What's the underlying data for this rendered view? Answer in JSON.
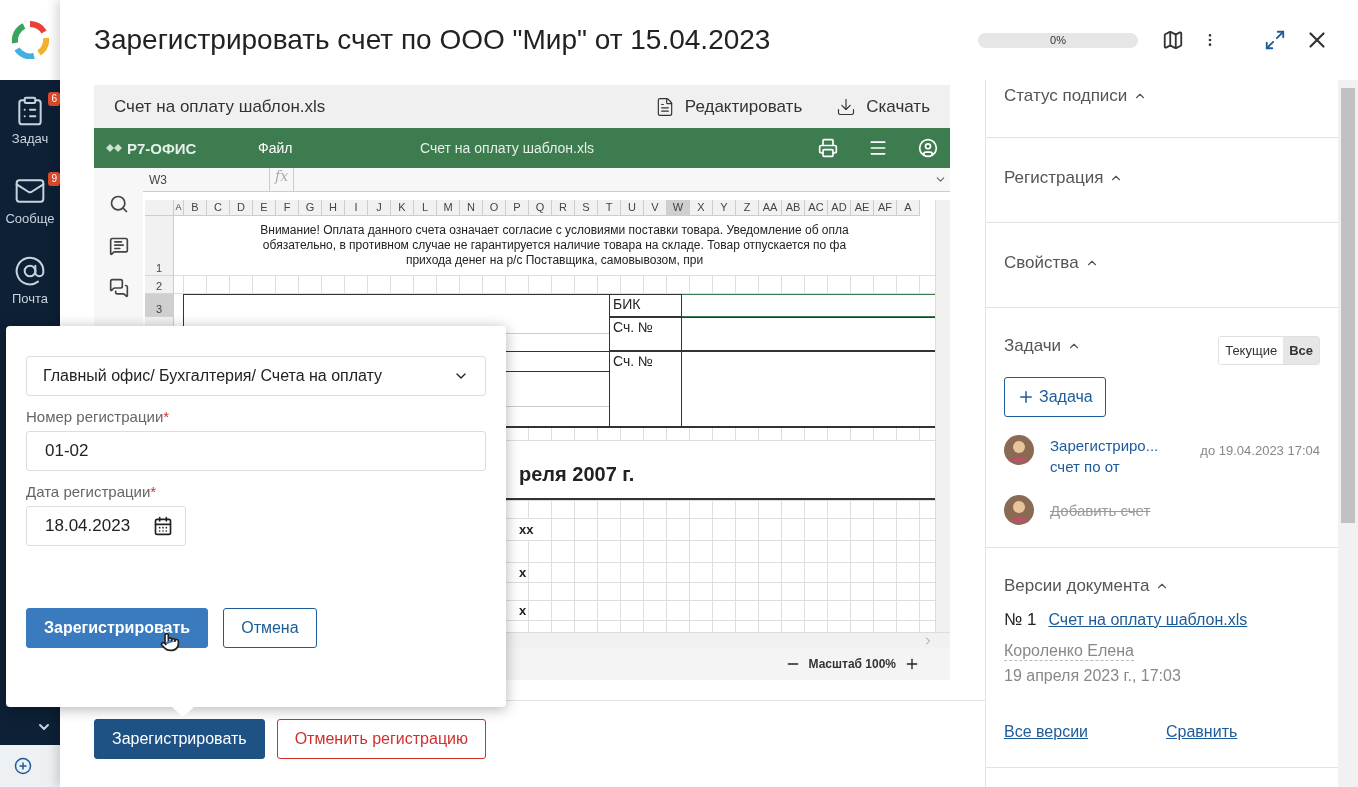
{
  "sidebar": {
    "items": [
      {
        "kind": "tasks",
        "label": "Задач",
        "badge": "6"
      },
      {
        "kind": "messages",
        "label": "Сообще",
        "badge": "9"
      },
      {
        "kind": "mail",
        "label": "Почта"
      }
    ]
  },
  "modal": {
    "title": "Зарегистрировать счет по ООО \"Мир\" от 15.04.2023",
    "progress": {
      "level": 0,
      "reading": "0%"
    }
  },
  "viewer": {
    "file_name": "Счет на оплату шаблон.xls",
    "actions": [
      {
        "kind": "edit",
        "label": "Редактировать"
      },
      {
        "kind": "download",
        "label": "Скачать"
      }
    ],
    "editor": {
      "brand": "Р7-ОФИС",
      "menu": "Файл",
      "title": "Счет на оплату шаблон.xls",
      "cell_ref": "W3",
      "formula_label": "fx"
    },
    "sheet": {
      "columns": [
        {
          "label": "A",
          "selected": false
        },
        {
          "label": "B",
          "selected": false
        },
        {
          "label": "C",
          "selected": false
        },
        {
          "label": "D",
          "selected": false
        },
        {
          "label": "E",
          "selected": false
        },
        {
          "label": "F",
          "selected": false
        },
        {
          "label": "G",
          "selected": false
        },
        {
          "label": "H",
          "selected": false
        },
        {
          "label": "I",
          "selected": false
        },
        {
          "label": "J",
          "selected": false
        },
        {
          "label": "K",
          "selected": false
        },
        {
          "label": "L",
          "selected": false
        },
        {
          "label": "M",
          "selected": false
        },
        {
          "label": "N",
          "selected": false
        },
        {
          "label": "O",
          "selected": false
        },
        {
          "label": "P",
          "selected": false
        },
        {
          "label": "Q",
          "selected": false
        },
        {
          "label": "R",
          "selected": false
        },
        {
          "label": "S",
          "selected": false
        },
        {
          "label": "T",
          "selected": false
        },
        {
          "label": "U",
          "selected": false
        },
        {
          "label": "V",
          "selected": false
        },
        {
          "label": "W",
          "selected": true
        },
        {
          "label": "X",
          "selected": false
        },
        {
          "label": "Y",
          "selected": false
        },
        {
          "label": "Z",
          "selected": false
        },
        {
          "label": "AA",
          "selected": false
        },
        {
          "label": "AB",
          "selected": false
        },
        {
          "label": "AC",
          "selected": false
        },
        {
          "label": "AD",
          "selected": false
        },
        {
          "label": "AE",
          "selected": false
        },
        {
          "label": "AF",
          "selected": false
        },
        {
          "label": "A",
          "selected": false
        }
      ],
      "row_numbers": [
        {
          "label": "1",
          "selected": false
        },
        {
          "label": "2",
          "selected": false
        },
        {
          "label": "3",
          "selected": true
        }
      ],
      "notice": [
        "Внимание! Оплата данного счета означает согласие с условиями поставки товара. Уведомление об опла",
        "обязательно, в противном случае не гарантируется наличие товара на складе. Товар отпускается по фа",
        "прихода денег на р/с Поставщика, самовывозом, при"
      ],
      "bank_labels": [
        "БИК",
        "Сч. №",
        "Сч. №"
      ],
      "heading": "реля 2007 г.",
      "lines": [
        "хх",
        "х",
        "х"
      ]
    },
    "zoom": "Масштаб 100%"
  },
  "footer_buttons": [
    {
      "kind": "primary",
      "label": "Зарегистрировать"
    },
    {
      "kind": "danger",
      "label": "Отменить регистрацию"
    }
  ],
  "panel": {
    "sections": [
      {
        "kind": "plain",
        "title": "Статус подписи",
        "expanded": true
      },
      {
        "kind": "plain",
        "title": "Регистрация",
        "expanded": true
      },
      {
        "kind": "plain",
        "title": "Свойства",
        "expanded": true
      },
      {
        "kind": "tasks",
        "title": "Задачи",
        "expanded": true,
        "filters": [
          {
            "label": "Текущие",
            "selected": false
          },
          {
            "label": "Все",
            "selected": true
          }
        ],
        "add_button": "Задача",
        "items": [
          {
            "title": "Зарегистриро...",
            "subtitle": "счет по от",
            "due": "до 19.04.2023 17:04",
            "done": false
          },
          {
            "title": "Добавить счет",
            "done": true
          }
        ]
      },
      {
        "kind": "versions",
        "title": "Версии документа",
        "expanded": true,
        "number": "№ 1",
        "file": "Счет на оплату шаблон.xls",
        "author": "Короленко Елена",
        "date": "19 апреля 2023 г., 17:03",
        "links": [
          "Все версии",
          "Сравнить"
        ]
      }
    ]
  },
  "popup": {
    "folder": "Главный офис/ Бухгалтерия/ Счета на оплату",
    "fields": [
      {
        "kind": "text",
        "label": "Номер регистрации",
        "mark": "*",
        "value": "01-02"
      },
      {
        "kind": "date",
        "label": "Дата регистрации",
        "mark": "*",
        "value": "18.04.2023"
      }
    ],
    "buttons": [
      {
        "kind": "primary",
        "label": "Зарегистрировать"
      },
      {
        "kind": "secondary",
        "label": "Отмена"
      }
    ]
  }
}
